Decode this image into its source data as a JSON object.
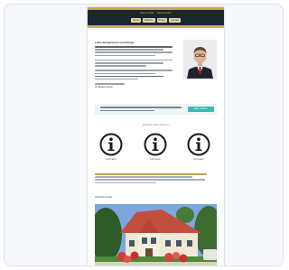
{
  "newsletter": {
    "header": {
      "title": "Gemeinde · Newsletter",
      "nav": [
        "Home",
        "Rathaus",
        "Bürger",
        "Kontakt"
      ]
    },
    "greeting": "Liebe Bürgerinnen und Bürger,",
    "signature": "Ihr Bürgermeister",
    "cta": {
      "button": "Mehr erfahren"
    },
    "section_title": "Aktuelle Informationen",
    "info_items": [
      {
        "icon": "info-icon",
        "caption": "Information"
      },
      {
        "icon": "info-icon",
        "caption": "Information"
      },
      {
        "icon": "info-icon",
        "caption": "Information"
      }
    ],
    "closing": "Herzliche Grüße"
  }
}
